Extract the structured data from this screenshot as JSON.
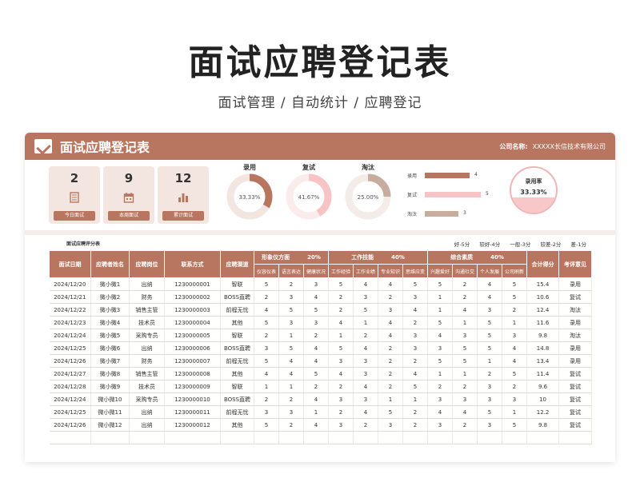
{
  "hero": {
    "title": "面试应聘登记表",
    "subtitle": "面试管理 / 自动统计 / 应聘登记"
  },
  "header": {
    "title": "面试应聘登记表",
    "company_label": "公司名称:",
    "company_name": "XXXXX长信技术有限公司"
  },
  "stats": [
    {
      "num": "2",
      "label": "今日面试",
      "icon": "document-icon"
    },
    {
      "num": "9",
      "label": "本周面试",
      "icon": "calendar-icon"
    },
    {
      "num": "12",
      "label": "累计面试",
      "icon": "bar-chart-icon"
    }
  ],
  "donuts": [
    {
      "title": "录用",
      "value": "33.33%",
      "fraction": 0.3333,
      "color": "#b87660",
      "track": "#f3e6e1"
    },
    {
      "title": "复试",
      "value": "41.67%",
      "fraction": 0.4167,
      "color": "#f6c4c4",
      "track": "#fbecec"
    },
    {
      "title": "淘汰",
      "value": "25.00%",
      "fraction": 0.25,
      "color": "#c8ad9f",
      "track": "#f3ece8"
    }
  ],
  "bars": [
    {
      "label": "录用",
      "value": 4,
      "display": "4",
      "color": "#b87660"
    },
    {
      "label": "复试",
      "value": 5,
      "display": "5",
      "color": "#f6c4c4"
    },
    {
      "label": "淘汰",
      "value": 3,
      "display": "3",
      "color": "#c8ad9f"
    }
  ],
  "rate": {
    "label": "录用率",
    "value": "33.33%",
    "fraction": 0.3333
  },
  "table": {
    "title": "面试应聘评分表",
    "legend": [
      "好-5分",
      "较好-4分",
      "一般-3分",
      "较差-2分",
      "差-1分"
    ],
    "headers": [
      "面试日期",
      "应聘者姓名",
      "应聘岗位",
      "联系方式",
      "应聘渠道"
    ],
    "groups": [
      {
        "name": "形象仪方面",
        "pct": "20%",
        "subs": [
          "仪容仪表",
          "语言表达",
          "健康状况"
        ]
      },
      {
        "name": "工作技能",
        "pct": "40%",
        "subs": [
          "工作经验",
          "工作业绩",
          "专业知识",
          "思维应变"
        ]
      },
      {
        "name": "综合素质",
        "pct": "40%",
        "subs": [
          "兴趣爱好",
          "沟通社交",
          "个人发展",
          "公司刷新"
        ]
      }
    ],
    "tail_headers": [
      "合计得分",
      "考评意见"
    ],
    "rows": [
      [
        "2024/12/20",
        "微小微1",
        "出纳",
        "1230000001",
        "智联",
        "5",
        "2",
        "3",
        "5",
        "4",
        "4",
        "5",
        "5",
        "2",
        "4",
        "5",
        "15.4",
        "录用"
      ],
      [
        "2024/12/21",
        "微小微2",
        "财务",
        "1230000002",
        "BOSS直聘",
        "2",
        "3",
        "4",
        "2",
        "3",
        "2",
        "3",
        "1",
        "2",
        "4",
        "5",
        "10.6",
        "复试"
      ],
      [
        "2024/12/22",
        "微小微3",
        "销售主管",
        "1230000003",
        "前程无忧",
        "4",
        "5",
        "5",
        "2",
        "5",
        "3",
        "4",
        "1",
        "4",
        "3",
        "2",
        "12.4",
        "淘汰"
      ],
      [
        "2024/12/23",
        "微小微4",
        "技术员",
        "1230000004",
        "其他",
        "5",
        "3",
        "3",
        "4",
        "1",
        "4",
        "2",
        "5",
        "1",
        "5",
        "1",
        "11.6",
        "录用"
      ],
      [
        "2024/12/24",
        "微小微5",
        "采购专员",
        "1230000005",
        "智联",
        "2",
        "1",
        "2",
        "1",
        "2",
        "4",
        "3",
        "4",
        "3",
        "5",
        "3",
        "9.8",
        "淘汰"
      ],
      [
        "2024/12/25",
        "微小微6",
        "出纳",
        "1230000006",
        "BOSS直聘",
        "3",
        "5",
        "4",
        "5",
        "4",
        "2",
        "3",
        "3",
        "5",
        "5",
        "4",
        "14.8",
        "录用"
      ],
      [
        "2024/12/26",
        "微小微7",
        "财务",
        "1230000007",
        "前程无忧",
        "5",
        "4",
        "4",
        "3",
        "3",
        "2",
        "2",
        "5",
        "5",
        "1",
        "4",
        "13.4",
        "录用"
      ],
      [
        "2024/12/27",
        "微小微8",
        "销售主管",
        "1230000008",
        "其他",
        "4",
        "4",
        "5",
        "4",
        "3",
        "2",
        "4",
        "1",
        "1",
        "2",
        "5",
        "11.4",
        "复试"
      ],
      [
        "2024/12/28",
        "微小微9",
        "技术员",
        "1230000009",
        "智联",
        "1",
        "1",
        "2",
        "2",
        "4",
        "2",
        "5",
        "2",
        "2",
        "3",
        "2",
        "9.6",
        "复试"
      ],
      [
        "2024/12/24",
        "微小微10",
        "采购专员",
        "1230000010",
        "BOSS直聘",
        "2",
        "2",
        "4",
        "3",
        "3",
        "1",
        "1",
        "3",
        "3",
        "3",
        "3",
        "10",
        "复试"
      ],
      [
        "2024/12/25",
        "微小微11",
        "出纳",
        "1230000011",
        "前程无忧",
        "3",
        "3",
        "1",
        "2",
        "4",
        "5",
        "2",
        "4",
        "4",
        "5",
        "1",
        "12.2",
        "复试"
      ],
      [
        "2024/12/26",
        "微小微12",
        "出纳",
        "1230000012",
        "其他",
        "5",
        "2",
        "4",
        "3",
        "2",
        "3",
        "2",
        "3",
        "2",
        "3",
        "5",
        "9.8",
        "复试"
      ]
    ]
  }
}
